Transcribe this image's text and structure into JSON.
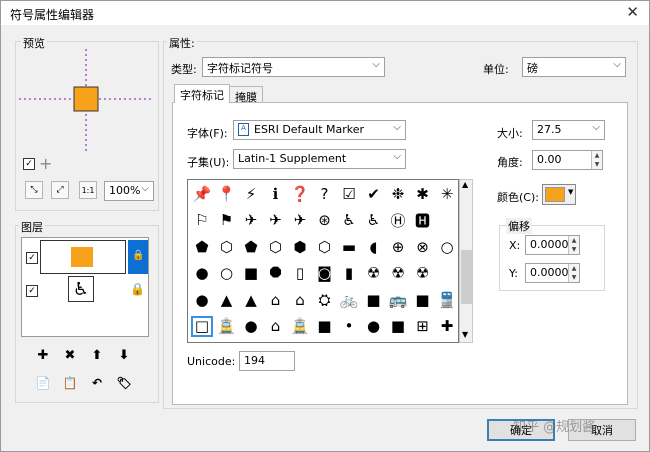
{
  "window": {
    "title": "符号属性编辑器",
    "close": "✕"
  },
  "preview": {
    "label": "预览",
    "zoom": "100%",
    "swatch": "#f7a21b"
  },
  "layers": {
    "label": "图层",
    "items": [
      {
        "checked": true,
        "swatch": "#f7a21b"
      },
      {
        "checked": true,
        "icon": "wheelchair-icon"
      }
    ]
  },
  "props": {
    "label": "属性:",
    "type_label": "类型:",
    "type_value": "字符标记符号",
    "unit_label": "单位:",
    "unit_value": "磅"
  },
  "tabs": [
    "字符标记",
    "掩膜"
  ],
  "font": {
    "label": "字体(F):",
    "value": "ESRI Default Marker"
  },
  "subset": {
    "label": "子集(U):",
    "value": "Latin-1 Supplement"
  },
  "size": {
    "label": "大小:",
    "value": "27.5"
  },
  "angle": {
    "label": "角度:",
    "value": "0.00"
  },
  "color": {
    "label": "颜色(C):",
    "value": "#f7a21b"
  },
  "offset": {
    "label": "偏移",
    "x_label": "X:",
    "x_value": "0.0000",
    "y_label": "Y:",
    "y_value": "0.0000"
  },
  "unicode": {
    "label": "Unicode:",
    "value": "194"
  },
  "buttons": {
    "ok": "确定",
    "cancel": "取消"
  },
  "watermark": "知乎 @规划酱",
  "glyphs": [
    [
      "📌",
      "📍",
      "⚡",
      "ℹ",
      "❓",
      "?",
      "☑",
      "✔",
      "❉",
      "✱",
      "✳"
    ],
    [
      "⚐",
      "⚑",
      "✈",
      "✈",
      "✈",
      "⊛",
      "♿",
      "♿",
      "Ⓗ",
      "🅷"
    ],
    [
      "⬟",
      "⬡",
      "⬟",
      "⬡",
      "⬢",
      "⬡",
      "▬",
      "◖",
      "⊕",
      "⊗",
      "○"
    ],
    [
      "●",
      "○",
      "■",
      "⯃",
      "▯",
      "◙",
      "▮",
      "☢",
      "☢",
      "☢"
    ],
    [
      "●",
      "▲",
      "▲",
      "⌂",
      "⌂",
      "⛭",
      "🚲",
      "■",
      "🚌",
      "■",
      "🚆"
    ],
    [
      "□",
      "🚊",
      "●",
      "⌂",
      "🚊",
      "■",
      "•",
      "●",
      "■",
      "⊞",
      "✚",
      "✚"
    ]
  ]
}
